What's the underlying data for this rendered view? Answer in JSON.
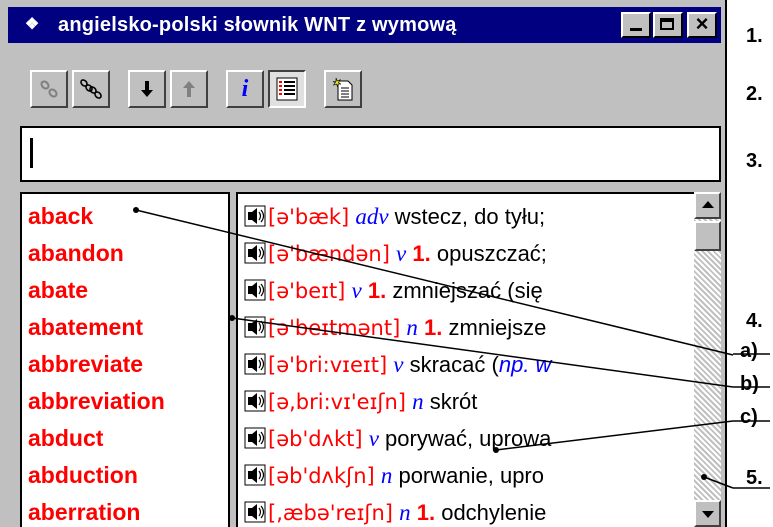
{
  "window": {
    "title": "angielsko-polski słownik WNT z wymową",
    "app_icon_glyph": "❖",
    "close_glyph": "×"
  },
  "search": {
    "value": "",
    "placeholder": ""
  },
  "words": [
    "aback",
    "abandon",
    "abate",
    "abatement",
    "abbreviate",
    "abbreviation",
    "abduct",
    "abduction",
    "aberration"
  ],
  "entries": [
    {
      "pron": "[ə'bæk]",
      "pos": "adv",
      "num": "",
      "text": "wstecz, do tyłu;"
    },
    {
      "pron": "[ə'bændən]",
      "pos": "v",
      "num": "1.",
      "text": "opuszczać;"
    },
    {
      "pron": "[ə'beɪt]",
      "pos": "v",
      "num": "1.",
      "text": "zmniejszać (się"
    },
    {
      "pron": "[ə'beɪtmənt]",
      "pos": "n",
      "num": "1.",
      "text": "zmniejsze"
    },
    {
      "pron": "[ə'bri:vɪeɪt]",
      "pos": "v",
      "num": "",
      "text": "skracać (",
      "extra": "np. w"
    },
    {
      "pron": "[ə,bri:vɪ'eɪʃn]",
      "pos": "n",
      "num": "",
      "text": "skrót"
    },
    {
      "pron": "[əb'dʌkt]",
      "pos": "v",
      "num": "",
      "text": "porywać, uprowa"
    },
    {
      "pron": "[əb'dʌkʃn]",
      "pos": "n",
      "num": "",
      "text": "porwanie, upro"
    },
    {
      "pron": "[,æbə'reɪʃn]",
      "pos": "n",
      "num": "1.",
      "text": "odchylenie"
    }
  ],
  "annotations": [
    "1.",
    "2.",
    "3.",
    "4.",
    "a)",
    "b)",
    "c)",
    "5."
  ],
  "colors": {
    "titlebar": "#000080",
    "headword": "#ff0000",
    "pos": "#0000ff",
    "chrome": "#c0c0c0"
  },
  "icons": [
    "link-icon",
    "unlink-icon",
    "arrow-down-icon",
    "arrow-up-icon",
    "info-icon",
    "list-icon",
    "new-note-icon",
    "speaker-icon"
  ]
}
